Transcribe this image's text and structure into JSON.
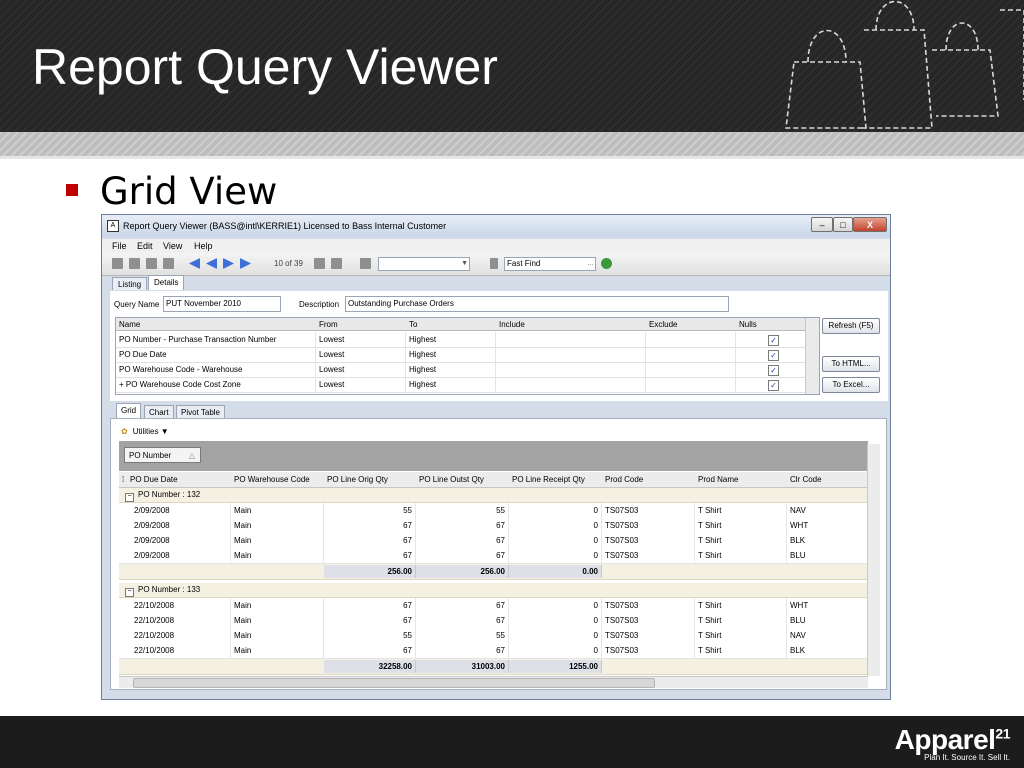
{
  "slide": {
    "title": "Report Query Viewer",
    "bullet": "Grid View",
    "logo_text": "Apparel",
    "logo_super": "21",
    "logo_tagline": "Plan It. Source It. Sell It."
  },
  "window": {
    "title": "Report Query Viewer (BASS@intl\\KERRIE1) Licensed to Bass Internal Customer",
    "minimize": "–",
    "maximize": "□",
    "close": "X"
  },
  "menu": [
    {
      "label": "File"
    },
    {
      "label": "Edit"
    },
    {
      "label": "View"
    },
    {
      "label": "Help"
    }
  ],
  "toolbar": {
    "pager": "10 of 39",
    "find_value": "Fast Find"
  },
  "top_tabs": [
    "Listing",
    "Details"
  ],
  "details": {
    "query_name_label": "Query Name",
    "query_name_value": "PUT November 2010",
    "description_label": "Description",
    "description_value": "Outstanding Purchase Orders"
  },
  "criteria": {
    "columns": [
      "Name",
      "From",
      "To",
      "Include",
      "Exclude",
      "Nulls"
    ],
    "rows": [
      {
        "name": "PO Number - Purchase Transaction Number",
        "from": "Lowest",
        "to": "Highest",
        "include": "",
        "exclude": "",
        "nulls": "✓"
      },
      {
        "name": "PO Due Date",
        "from": "Lowest",
        "to": "Highest",
        "include": "",
        "exclude": "",
        "nulls": "✓"
      },
      {
        "name": "PO Warehouse Code - Warehouse",
        "from": "Lowest",
        "to": "Highest",
        "include": "",
        "exclude": "",
        "nulls": "✓"
      },
      {
        "name": "+ PO Warehouse Code Cost Zone",
        "from": "Lowest",
        "to": "Highest",
        "include": "",
        "exclude": "",
        "nulls": "✓"
      }
    ]
  },
  "buttons": {
    "refresh": "Refresh (F5)",
    "to_html": "To HTML...",
    "to_excel": "To Excel..."
  },
  "lower_tabs": [
    "Grid",
    "Chart",
    "Pivot Table"
  ],
  "grid": {
    "utilities": "Utilities",
    "group_chip": "PO Number",
    "columns": [
      "PO Due Date",
      "PO Warehouse Code",
      "PO Line Orig Qty",
      "PO Line Outst Qty",
      "PO Line Receipt Qty",
      "Prod Code",
      "Prod Name",
      "Clr Code"
    ],
    "groups": [
      {
        "label": "PO Number : 132",
        "rows": [
          [
            "2/09/2008",
            "Main",
            "55",
            "55",
            "0",
            "TS07S03",
            "T Shirt",
            "NAV"
          ],
          [
            "2/09/2008",
            "Main",
            "67",
            "67",
            "0",
            "TS07S03",
            "T Shirt",
            "WHT"
          ],
          [
            "2/09/2008",
            "Main",
            "67",
            "67",
            "0",
            "TS07S03",
            "T Shirt",
            "BLK"
          ],
          [
            "2/09/2008",
            "Main",
            "67",
            "67",
            "0",
            "TS07S03",
            "T Shirt",
            "BLU"
          ]
        ],
        "totals": [
          "256.00",
          "256.00",
          "0.00"
        ]
      },
      {
        "label": "PO Number : 133",
        "rows": [
          [
            "22/10/2008",
            "Main",
            "67",
            "67",
            "0",
            "TS07S03",
            "T Shirt",
            "WHT"
          ],
          [
            "22/10/2008",
            "Main",
            "67",
            "67",
            "0",
            "TS07S03",
            "T Shirt",
            "BLU"
          ],
          [
            "22/10/2008",
            "Main",
            "55",
            "55",
            "0",
            "TS07S03",
            "T Shirt",
            "NAV"
          ],
          [
            "22/10/2008",
            "Main",
            "67",
            "67",
            "0",
            "TS07S03",
            "T Shirt",
            "BLK"
          ]
        ],
        "totals": [
          "32258.00",
          "31003.00",
          "1255.00"
        ]
      }
    ]
  }
}
